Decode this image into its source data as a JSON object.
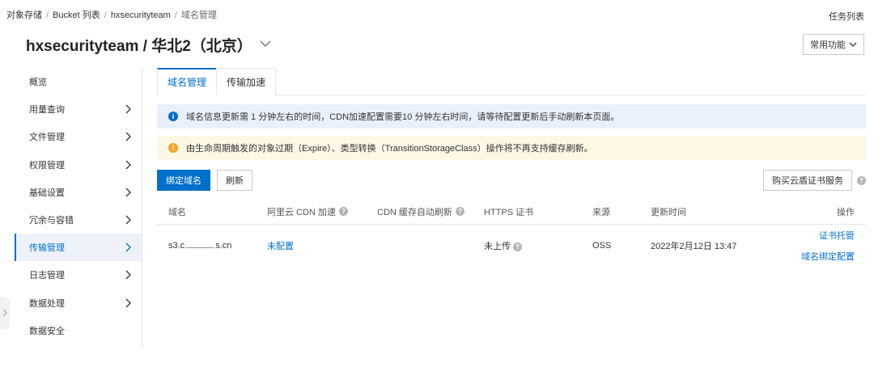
{
  "breadcrumb": {
    "items": [
      "对象存储",
      "Bucket 列表",
      "hxsecurityteam"
    ],
    "current": "域名管理"
  },
  "header": {
    "task_list": "任务列表",
    "title": "hxsecurityteam / 华北2（北京）",
    "common_functions": "常用功能"
  },
  "sidebar": {
    "items": [
      {
        "label": "概览",
        "chevron": false
      },
      {
        "label": "用量查询",
        "chevron": true
      },
      {
        "label": "文件管理",
        "chevron": true
      },
      {
        "label": "权限管理",
        "chevron": true
      },
      {
        "label": "基础设置",
        "chevron": true
      },
      {
        "label": "冗余与容错",
        "chevron": true
      },
      {
        "label": "传输管理",
        "chevron": true,
        "active": true
      },
      {
        "label": "日志管理",
        "chevron": true
      },
      {
        "label": "数据处理",
        "chevron": true
      },
      {
        "label": "数据安全",
        "chevron": false
      }
    ]
  },
  "tabs": [
    {
      "label": "域名管理",
      "active": true
    },
    {
      "label": "传输加速",
      "active": false
    }
  ],
  "alerts": {
    "info": "域名信息更新需 1 分钟左右的时间，CDN加速配置需要10 分钟左右时间，请等待配置更新后手动刷新本页面。",
    "warning": "由生命周期触发的对象过期（Expire）、类型转换（TransitionStorageClass）操作将不再支持缓存刷新。"
  },
  "toolbar": {
    "bind_domain": "绑定域名",
    "refresh": "刷新",
    "buy_cert": "购买云盾证书服务"
  },
  "table": {
    "headers": {
      "domain": "域名",
      "cdn": "阿里云 CDN 加速",
      "auto_refresh": "CDN 缓存自动刷新",
      "https": "HTTPS 证书",
      "source": "来源",
      "updated": "更新时间",
      "ops": "操作"
    },
    "rows": [
      {
        "domain_prefix": "s3.c",
        "domain_suffix": "s.cn",
        "cdn": "未配置",
        "auto_refresh": "",
        "https": "未上传",
        "source": "OSS",
        "updated": "2022年2月12日 13:47",
        "op1": "证书托管",
        "op2": "域名绑定配置"
      }
    ]
  },
  "colors": {
    "accent": "#0070cc",
    "info_bg": "#e8f1fb",
    "warn_bg": "#fdf7e6",
    "warn_icon": "#f5a623"
  }
}
